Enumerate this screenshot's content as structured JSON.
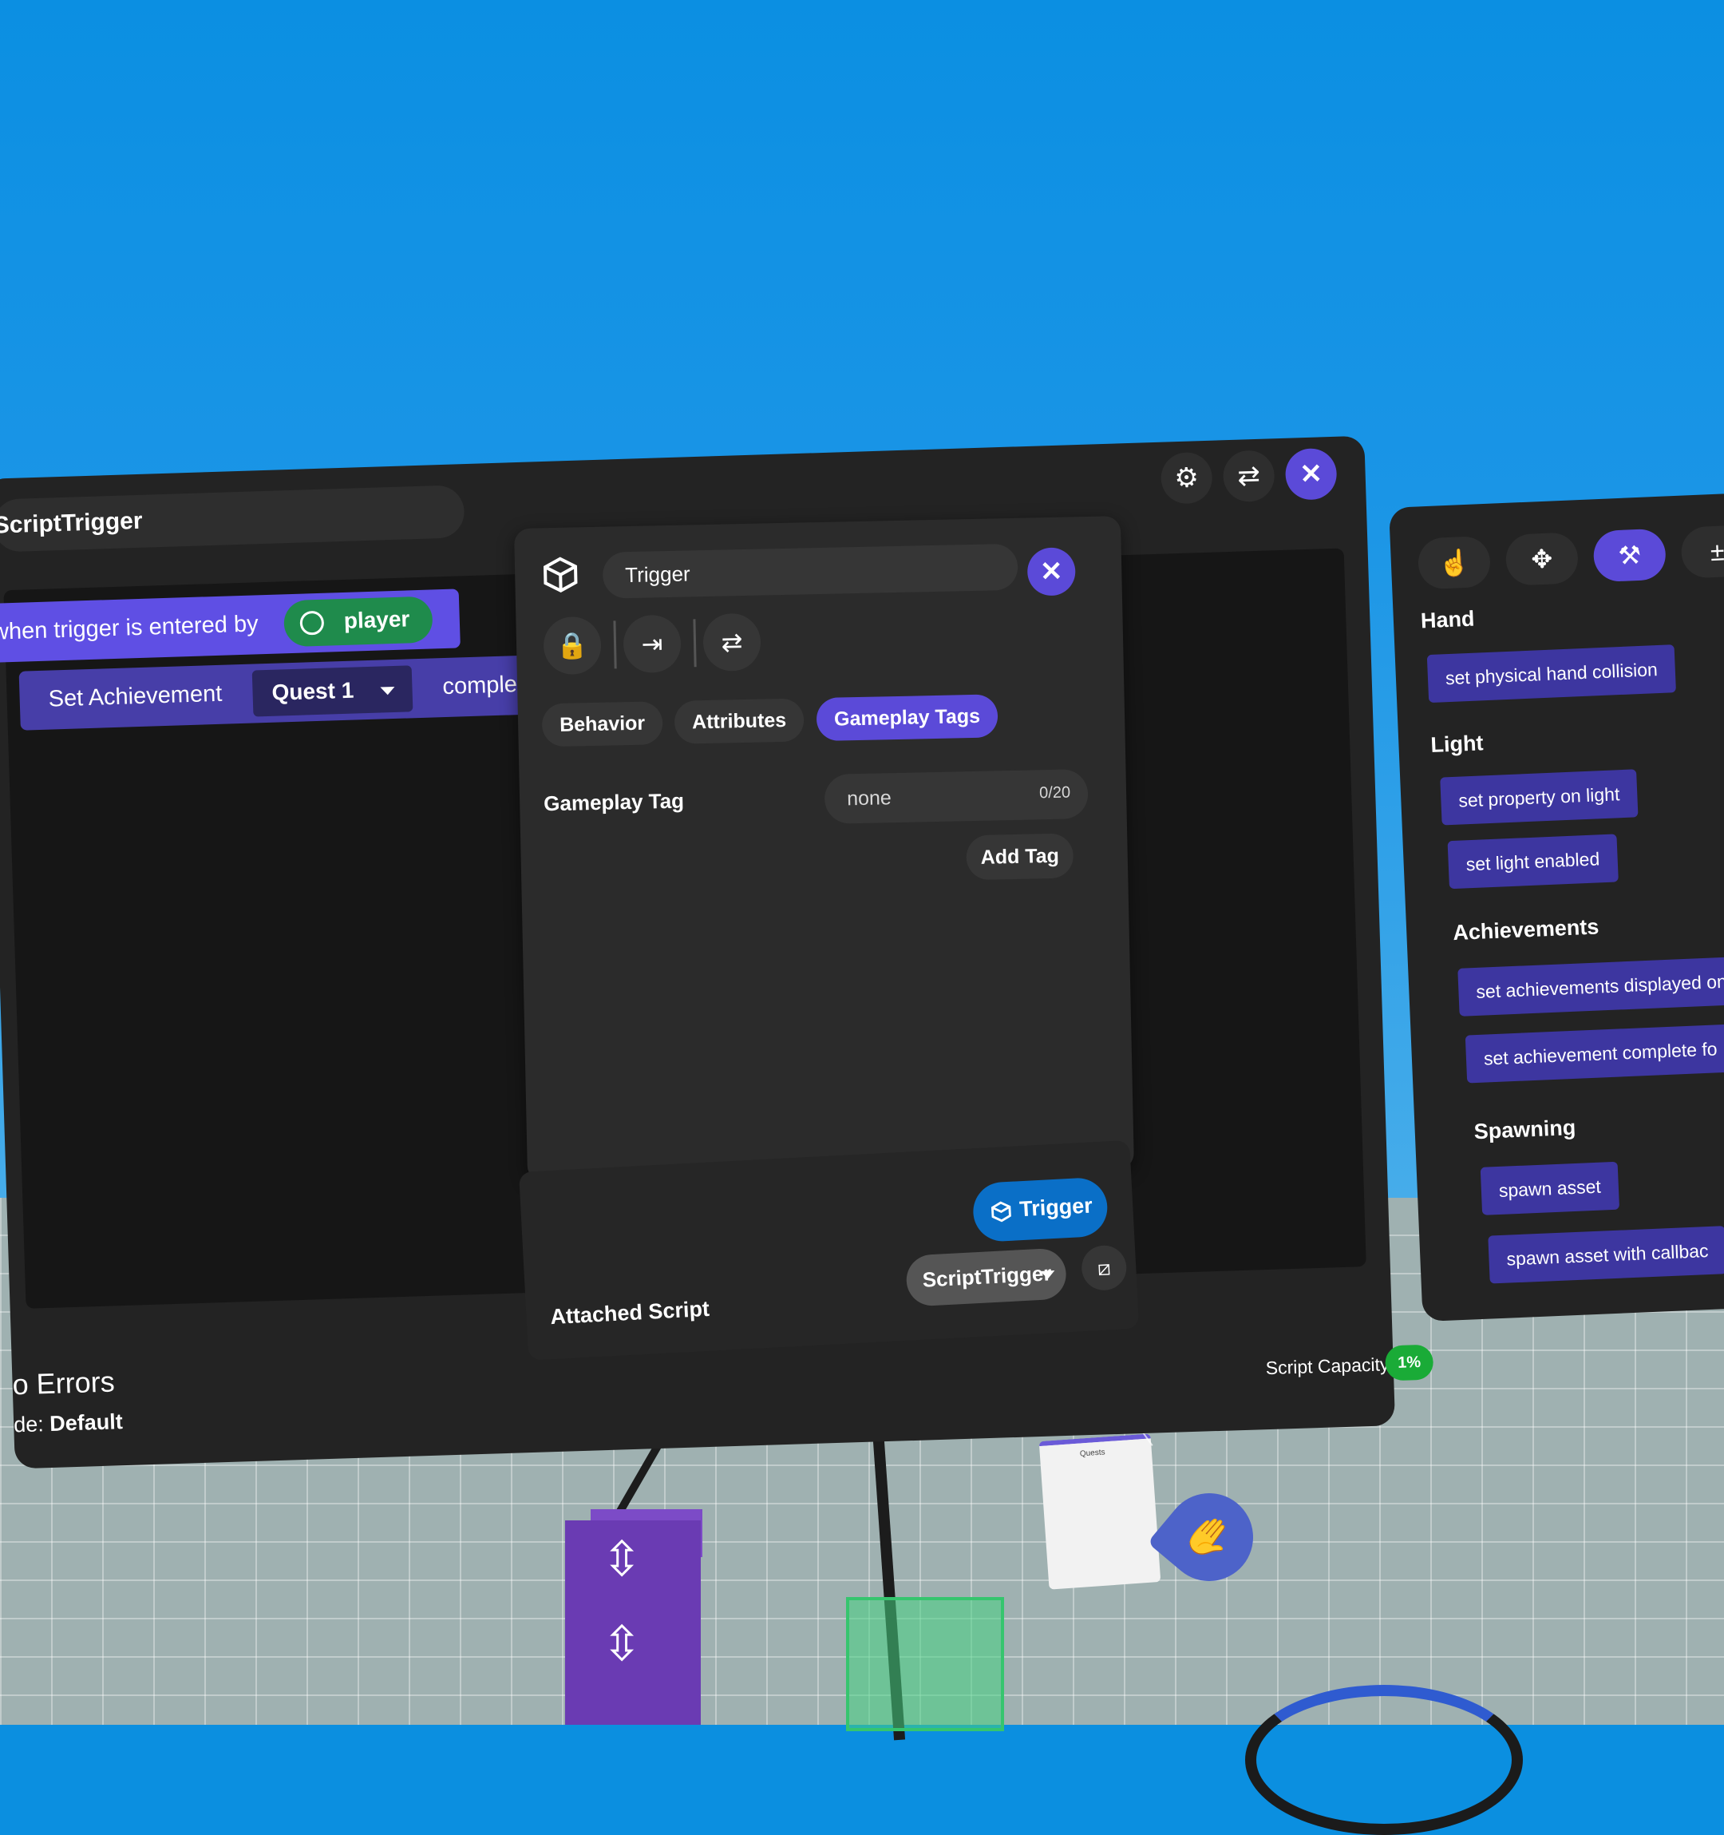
{
  "script_panel": {
    "title": "ScriptTrigger",
    "event_prefix": "when trigger is entered by",
    "event_param": "player",
    "action_label": "Set Achievement",
    "action_param": "Quest 1",
    "action_suffix": "complete",
    "errors_text": "o Errors",
    "mode_label": "de:",
    "mode_value": "Default",
    "capacity_label": "Script Capacity",
    "capacity_value": "1%",
    "icons": [
      "gear-icon",
      "swap-icon",
      "close-icon"
    ]
  },
  "property_popup": {
    "object_name": "Trigger",
    "tabs": [
      {
        "label": "Behavior",
        "active": false
      },
      {
        "label": "Attributes",
        "active": false
      },
      {
        "label": "Gameplay Tags",
        "active": true
      }
    ],
    "gameplay_tag_label": "Gameplay Tag",
    "tag_value": "none",
    "tag_count": "0/20",
    "add_tag_label": "Add Tag",
    "tools": [
      "lock-icon",
      "import-icon",
      "swap-icon"
    ]
  },
  "attached": {
    "label": "Attached Script",
    "object_pill": "Trigger",
    "script_name": "ScriptTrigger"
  },
  "palette": {
    "sections": [
      {
        "title": "Hand",
        "items": [
          "set physical hand collision"
        ]
      },
      {
        "title": "Light",
        "items": [
          "set property on light",
          "set light enabled"
        ]
      },
      {
        "title": "Achievements",
        "items": [
          "set achievements displayed on",
          "set achievement complete fo"
        ]
      },
      {
        "title": "Spawning",
        "items": [
          "spawn asset",
          "spawn asset with callbac"
        ]
      }
    ],
    "top_icons": [
      "touch-icon",
      "move-icon",
      "hammer-icon",
      "math-icon"
    ]
  },
  "scene": {
    "card_title": "Quests"
  },
  "colors": {
    "accent": "#5b4ad8",
    "event_block": "#5f4fe4",
    "player_pill": "#1f8b4c",
    "trigger_pill": "#0a6fc7",
    "capacity_badge": "#1aab37"
  }
}
